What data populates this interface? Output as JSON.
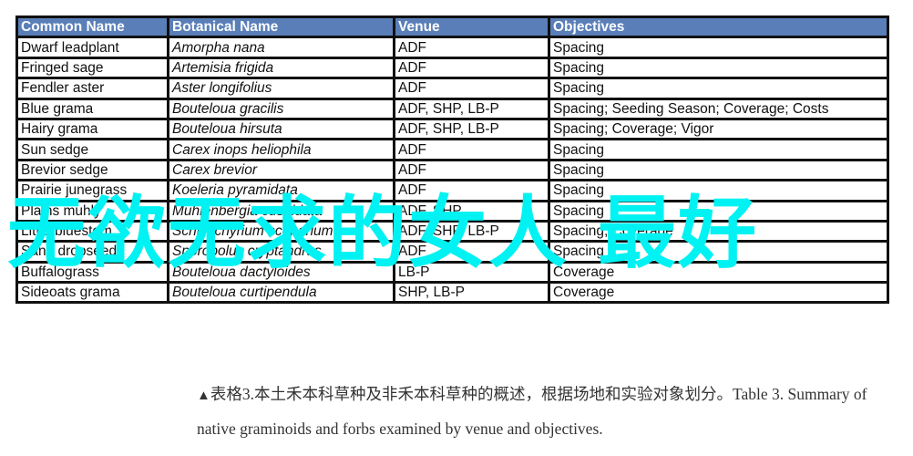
{
  "table": {
    "headers": [
      "Common Name",
      "Botanical  Name",
      "Venue",
      "Objectives"
    ],
    "rows": [
      [
        "Dwarf leadplant",
        "Amorpha nana",
        "ADF",
        "Spacing"
      ],
      [
        "Fringed sage",
        "Artemisia frigida",
        "ADF",
        "Spacing"
      ],
      [
        "Fendler aster",
        "Aster longifolius",
        "ADF",
        "Spacing"
      ],
      [
        "Blue grama",
        "Bouteloua gracilis",
        "ADF, SHP, LB-P",
        "Spacing; Seeding Season;  Coverage; Costs"
      ],
      [
        "Hairy grama",
        "Bouteloua hirsuta",
        "ADF, SHP, LB-P",
        "Spacing; Coverage; Vigor"
      ],
      [
        "Sun sedge",
        "Carex inops heliophila",
        "ADF",
        "Spacing"
      ],
      [
        "Brevior sedge",
        "Carex brevior",
        "ADF",
        "Spacing"
      ],
      [
        "Prairie junegrass",
        "Koeleria pyramidata",
        "ADF",
        "Spacing"
      ],
      [
        "Plains muhly",
        "Muhlenbergia cuspidata",
        "ADF, SHP",
        "Spacing"
      ],
      [
        "Little bluestem",
        "Schizachyrium scoparium",
        "ADF, SHP, LB-P",
        "Spacing; Coverage"
      ],
      [
        "Sand dropseed",
        "Sporobolus cryptandrus",
        "ADF",
        "Spacing"
      ],
      [
        "Buffalograss",
        "Bouteloua dactyloides",
        "LB-P",
        "Coverage"
      ],
      [
        "Sideoats grama",
        "Bouteloua curtipendula",
        "SHP, LB-P",
        "Coverage"
      ]
    ]
  },
  "watermark": "无欲无求的女人 最好",
  "caption": {
    "marker": "▲",
    "text": "表格3.本土禾本科草种及非禾本科草种的概述，根据场地和实验对象划分。Table 3. Summary of native graminoids and forbs examined by venue and objectives."
  },
  "colors": {
    "header_bg": "#5a7fb8",
    "watermark": "#00f2f2"
  }
}
